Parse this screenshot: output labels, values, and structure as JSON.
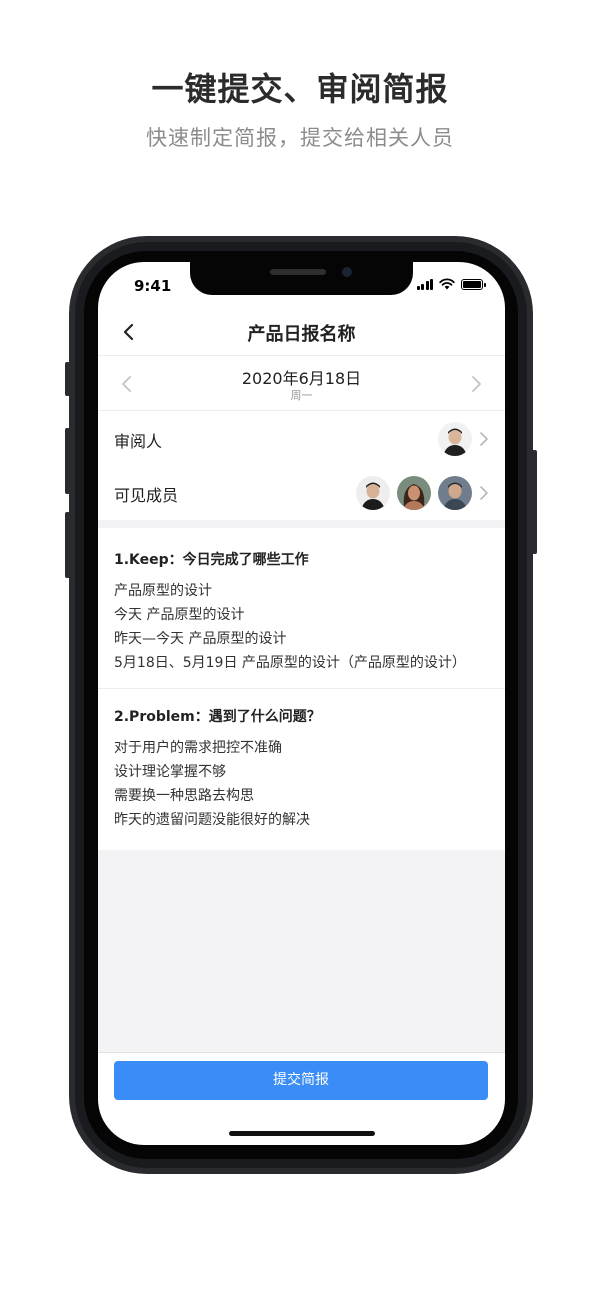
{
  "promo": {
    "title": "一键提交、审阅简报",
    "subtitle": "快速制定简报，提交给相关人员"
  },
  "status_bar": {
    "time": "9:41"
  },
  "navbar": {
    "back_icon": "chevron-left-icon",
    "title": "产品日报名称"
  },
  "date_bar": {
    "date": "2020年6月18日",
    "weekday": "周一"
  },
  "reviewer": {
    "label": "审阅人"
  },
  "members": {
    "label": "可见成员"
  },
  "sections": [
    {
      "title": "1.Keep：今日完成了哪些工作",
      "lines": [
        "产品原型的设计",
        "今天 产品原型的设计",
        "昨天—今天 产品原型的设计",
        "5月18日、5月19日 产品原型的设计（产品原型的设计）"
      ]
    },
    {
      "title": "2.Problem：遇到了什么问题？",
      "lines": [
        "对于用户的需求把控不准确",
        "设计理论掌握不够",
        "需要换一种思路去构思",
        "昨天的遗留问题没能很好的解决"
      ]
    }
  ],
  "submit": {
    "label": "提交简报"
  },
  "colors": {
    "accent": "#3a8df6",
    "background_grey": "#f3f3f5"
  }
}
